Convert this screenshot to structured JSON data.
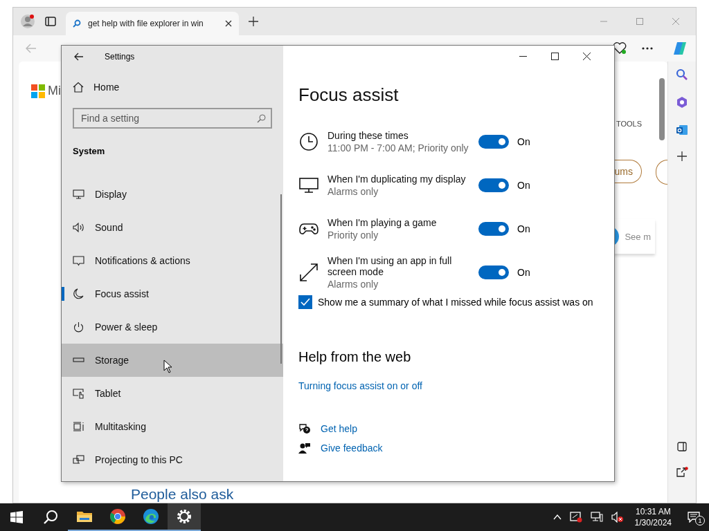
{
  "browser": {
    "tab_title": "get help with file explorer in win",
    "logo_text": "Mi",
    "tools_label": "TOOLS",
    "pill_text": "ums",
    "see_more": "See m",
    "heading": "People also ask"
  },
  "settings": {
    "title": "Settings",
    "home": "Home",
    "search": {
      "placeholder": "Find a setting"
    },
    "section": "System",
    "nav": [
      {
        "label": "Display",
        "selected": false,
        "hovered": false
      },
      {
        "label": "Sound",
        "selected": false,
        "hovered": false
      },
      {
        "label": "Notifications & actions",
        "selected": false,
        "hovered": false
      },
      {
        "label": "Focus assist",
        "selected": true,
        "hovered": false
      },
      {
        "label": "Power & sleep",
        "selected": false,
        "hovered": false
      },
      {
        "label": "Storage",
        "selected": false,
        "hovered": true
      },
      {
        "label": "Tablet",
        "selected": false,
        "hovered": false
      },
      {
        "label": "Multitasking",
        "selected": false,
        "hovered": false
      },
      {
        "label": "Projecting to this PC",
        "selected": false,
        "hovered": false
      }
    ],
    "page_title": "Focus assist",
    "rules": [
      {
        "title": "During these times",
        "subtitle": "11:00 PM - 7:00 AM; Priority only",
        "on": true,
        "state_label": "On"
      },
      {
        "title": "When I'm duplicating my display",
        "subtitle": "Alarms only",
        "on": true,
        "state_label": "On"
      },
      {
        "title": "When I'm playing a game",
        "subtitle": "Priority only",
        "on": true,
        "state_label": "On"
      },
      {
        "title": "When I'm using an app in full screen mode",
        "subtitle": "Alarms only",
        "on": true,
        "state_label": "On"
      }
    ],
    "summary": {
      "label": "Show me a summary of what I missed while focus assist was on",
      "checked": true
    },
    "help_heading": "Help from the web",
    "help_link": "Turning focus assist on or off",
    "actions": [
      {
        "label": "Get help"
      },
      {
        "label": "Give feedback"
      }
    ]
  },
  "taskbar": {
    "apps": [
      {
        "kind": "explorer",
        "active": false
      },
      {
        "kind": "chrome",
        "active": false
      },
      {
        "kind": "edge",
        "active": false
      },
      {
        "kind": "settings",
        "active": true
      }
    ],
    "time": "10:31 AM",
    "date": "1/30/2024",
    "notification_count": "1"
  }
}
